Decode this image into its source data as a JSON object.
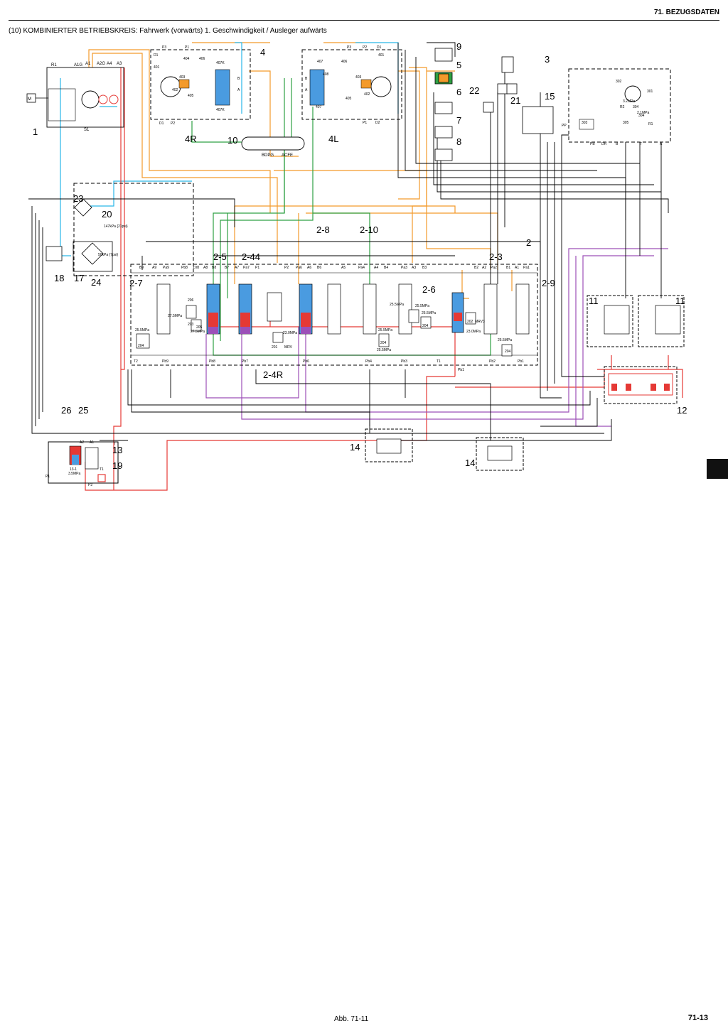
{
  "header": {
    "section": "71. BEZUGSDATEN"
  },
  "subtitle": "(10) KOMBINIERTER BETRIEBSKREIS: Fahrwerk (vorwärts) 1. Geschwindigkeit / Ausleger aufwärts",
  "figure_caption": "Abb. 71-11",
  "page_number": "71-13",
  "callouts": [
    "1",
    "2",
    "2-3",
    "2-4R",
    "2-5",
    "2-6",
    "2-7",
    "2-8",
    "2-9",
    "2-10",
    "2-44",
    "3",
    "4",
    "4R",
    "4L",
    "5",
    "6",
    "7",
    "8",
    "9",
    "10",
    "11",
    "11",
    "12",
    "13",
    "14",
    "14",
    "15",
    "17",
    "18",
    "19",
    "20",
    "21",
    "22",
    "23",
    "24",
    "25",
    "26"
  ],
  "small_labels": {
    "pump": [
      "R1",
      "A1G",
      "A1",
      "A2G",
      "A4",
      "A3",
      "M",
      "S1"
    ],
    "travel_right": [
      "D1",
      "P3",
      "P1",
      "401",
      "404",
      "406",
      "403",
      "407K",
      "402",
      "405",
      "407K",
      "D1",
      "P2",
      "B",
      "A"
    ],
    "travel_left": [
      "P3",
      "P2",
      "D1",
      "401",
      "407",
      "408",
      "406",
      "402",
      "403",
      "407",
      "405",
      "P1",
      "D2",
      "B",
      "A"
    ],
    "swivel": [
      "BDPG",
      "ACFE"
    ],
    "pilot_block": [
      "PP",
      "303",
      "302",
      "301",
      "304",
      "305",
      "304",
      "R1",
      "PB",
      "DR",
      "B",
      "T",
      "A",
      "R2",
      "3.2MPa",
      "2.1MPa"
    ],
    "valve_ports_top": [
      "B9",
      "A9",
      "Pa9",
      "Pb8",
      "Dr8",
      "A8",
      "B8",
      "B7",
      "A7",
      "Pa7",
      "P1",
      "P2",
      "Pa6",
      "A6",
      "B6",
      "A5",
      "Pa4",
      "A4",
      "B4",
      "Pa3",
      "A3",
      "B3",
      "B2",
      "A2",
      "Pa2",
      "B1",
      "A1",
      "Pa1"
    ],
    "valve_ports_bottom": [
      "T2",
      "Pb9",
      "Pb8",
      "Pb7",
      "Pb6",
      "Pb4",
      "Pb3",
      "T1",
      "Pb2",
      "Pb1",
      "Pb1"
    ],
    "pressures": [
      "25.5MPa",
      "27.5MPa",
      "27.5MPa",
      "23.0MPa",
      "25.5MPa",
      "25.5MPa",
      "25.5MPa",
      "25.5MPa",
      "25.5MPa",
      "23.0MPa",
      "25.5MPa",
      "147kPa {21psi}",
      "50kPa {7psi}",
      "3.5MPa"
    ],
    "valve_codes": [
      "204",
      "206",
      "203",
      "205",
      "201",
      "MRV",
      "204",
      "204",
      "202",
      "MRV3",
      "204",
      "13-1",
      "P1",
      "P2",
      "A1",
      "A2",
      "T1",
      "T"
    ]
  },
  "colors": {
    "pilot_orange": "#f39a2b",
    "drain_cyan": "#29b6e8",
    "pressure_red": "#e53935",
    "return_green": "#2ea043",
    "pilot_purple": "#9c4fb8",
    "spool_blue": "#4a9be0",
    "line_black": "#000000"
  }
}
